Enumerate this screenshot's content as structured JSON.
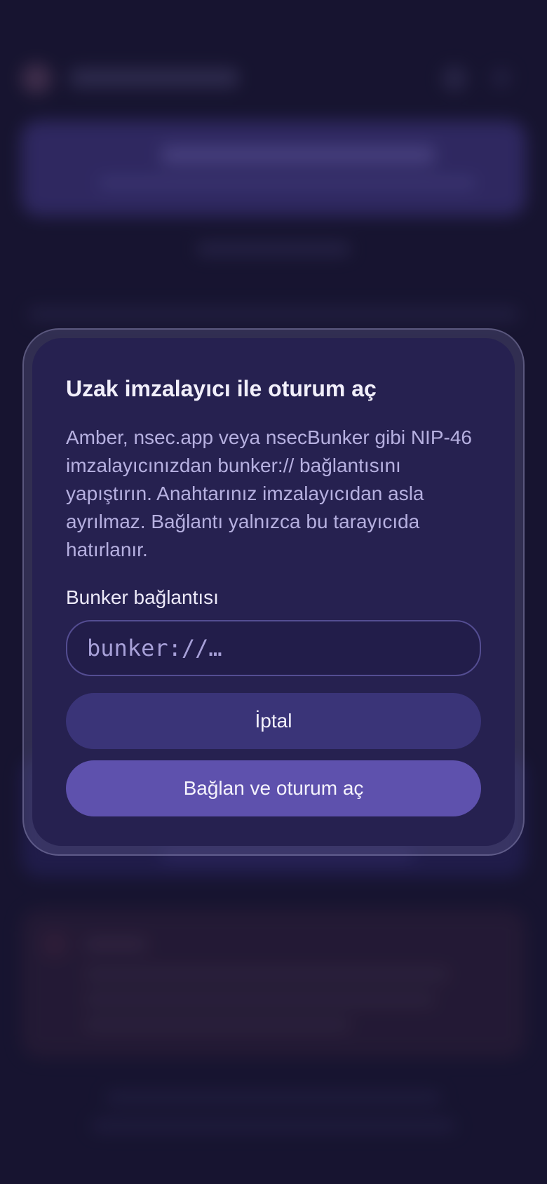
{
  "dialog": {
    "title": "Uzak imzalayıcı ile oturum aç",
    "description": "Amber, nsec.app veya nsecBunker gibi NIP-46 imzalayıcınızdan bunker:// bağlantısını yapıştırın. Anahtarınız imzalayıcıdan asla ayrılmaz. Bağlantı yalnızca bu tarayıcıda hatırlanır.",
    "field_label": "Bunker bağlantısı",
    "field_placeholder": "bunker://…",
    "field_value": "",
    "cancel_label": "İptal",
    "confirm_label": "Bağlan ve oturum aç"
  },
  "colors": {
    "page_background": "#1a1733",
    "dialog_background": "#262150",
    "primary_button": "#5e51ad",
    "secondary_button": "#3a3478"
  }
}
